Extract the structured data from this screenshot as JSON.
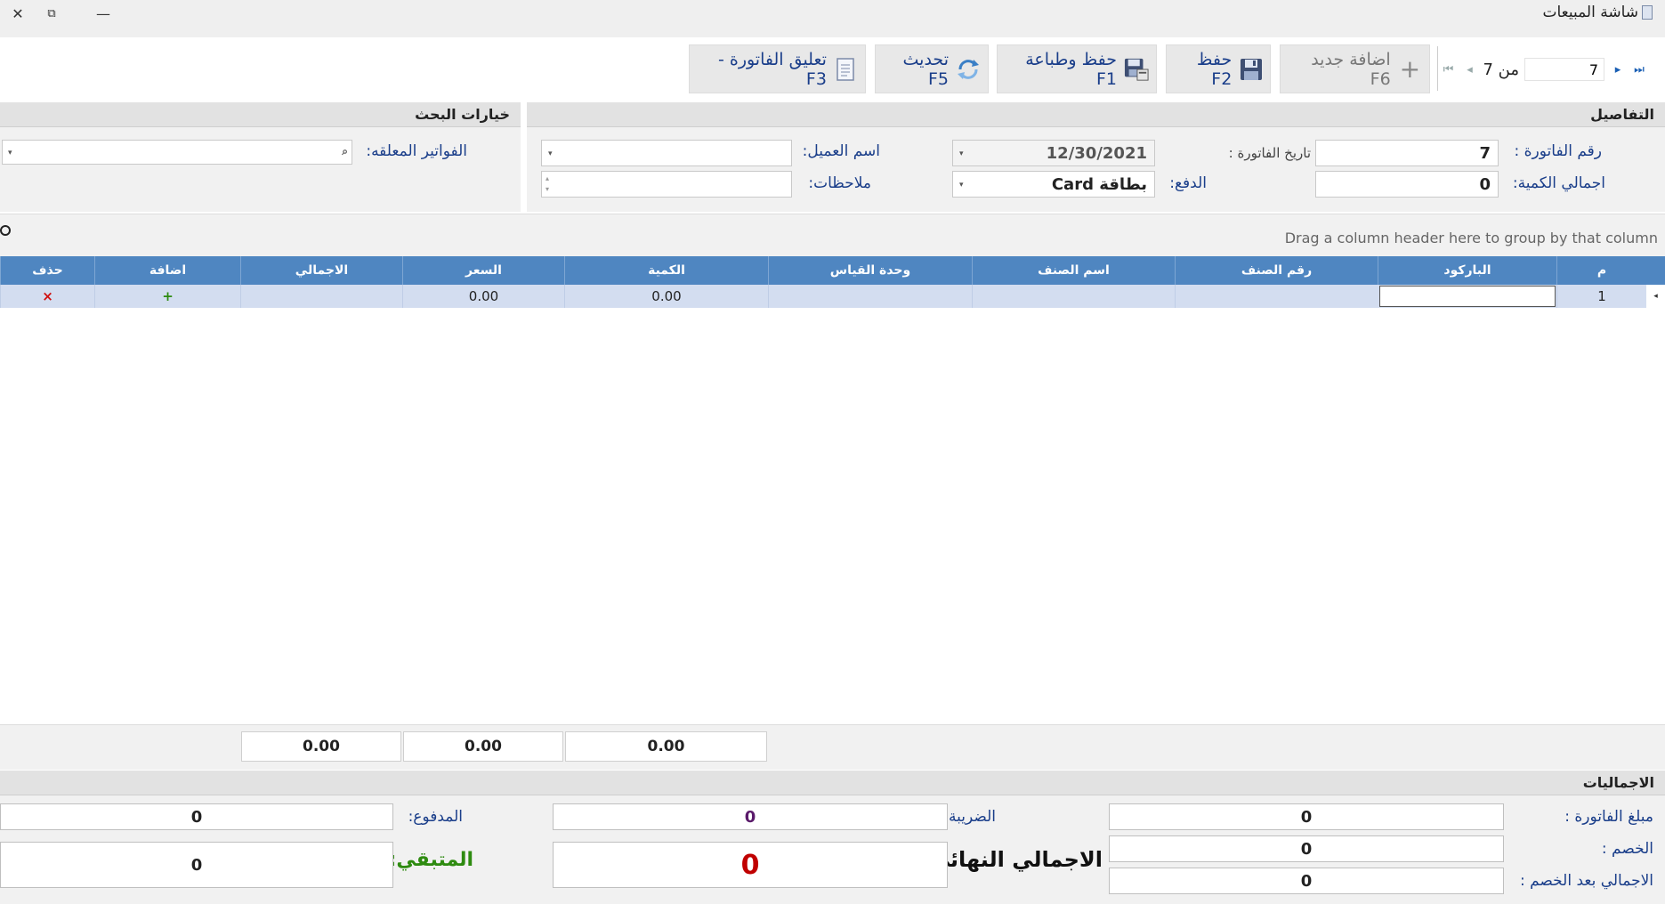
{
  "window": {
    "title": "شاشة المبيعات"
  },
  "toolbar": {
    "hold_invoice": "تعليق الفاتورة - F3",
    "refresh": "تحديث F5",
    "save_print": "حفظ وطباعة F1",
    "save": "حفظ  F2",
    "add_new": "اضافة جديد F6"
  },
  "pager": {
    "current": "7",
    "of_label": "من 7"
  },
  "details": {
    "header": "التفاصيل",
    "invoice_no_label": "رقم الفاتورة :",
    "invoice_no": "7",
    "total_qty_label": "اجمالي الكمية:",
    "total_qty": "0",
    "invoice_date_label": "تاريخ الفاتورة :",
    "invoice_date": "12/30/2021",
    "payment_label": "الدفع:",
    "payment": "Card بطاقة",
    "customer_label": "اسم العميل:",
    "notes_label": "ملاحظات:"
  },
  "search": {
    "header": "خيارات البحث",
    "held_label": "الفواتير المعلقه:"
  },
  "grid": {
    "group_hint": "Drag a column header here to group by that column",
    "columns": [
      "م",
      "الباركود",
      "رقم الصنف",
      "اسم الصنف",
      "وحدة القياس",
      "الكمية",
      "السعر",
      "الاجمالي",
      "اضافة",
      "حذف"
    ],
    "rows": [
      {
        "num": "1",
        "qty": "0.00",
        "price": "0.00",
        "add": "+",
        "del": "×"
      }
    ],
    "summary": {
      "qty": "0.00",
      "price": "0.00",
      "total": "0.00"
    }
  },
  "totals": {
    "header": "الاجماليات",
    "invoice_amount_label": "مبلغ الفاتورة :",
    "invoice_amount": "0",
    "discount_label": "الخصم :",
    "discount": "0",
    "after_discount_label": "الاجمالي بعد الخصم :",
    "after_discount": "0",
    "tax_label": "الضريبة :",
    "tax": "0",
    "final_label": "الاجمالي النهائي:",
    "final": "0",
    "paid_label": "المدفوع:",
    "paid": "0",
    "remaining_label": "المتبقي:",
    "remaining": "0"
  },
  "colors": {
    "grid_header": "#4f86c1",
    "grid_row": "#d3ddf0",
    "label": "#1a3e8a",
    "final": "#c00000",
    "remaining": "#2e8b10"
  }
}
